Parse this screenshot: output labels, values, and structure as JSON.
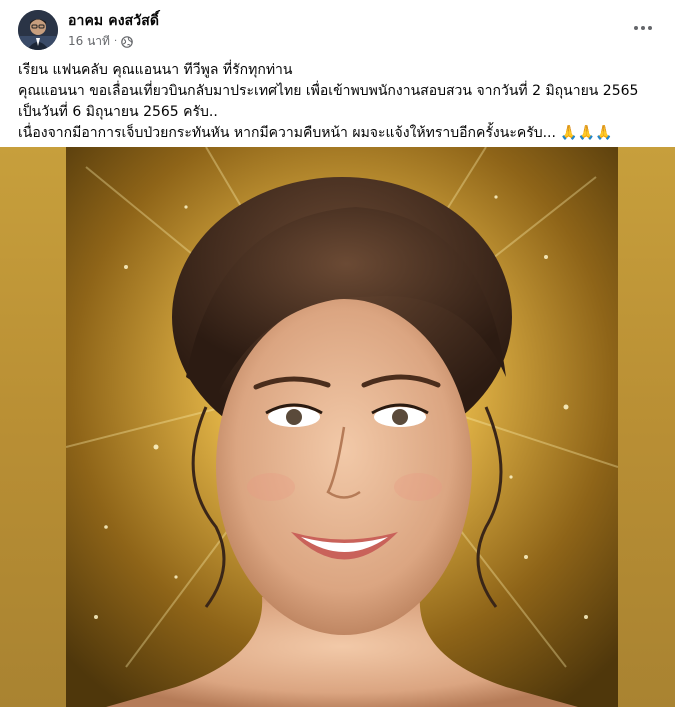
{
  "post": {
    "author": "อาคม คงสวัสดิ์",
    "time": "16 นาที",
    "dot": "·",
    "lines": [
      "เรียน แฟนคลับ คุณแอนนา ทีวีพูล ที่รักทุกท่าน",
      "คุณแอนนา ขอเลื่อนเที่ยวบินกลับมาประเทศไทย เพื่อเข้าพบพนักงานสอบสวน จากวันที่ 2 มิถุนายน 2565",
      "เป็นวันที่ 6 มิถุนายน 2565 ครับ..",
      "เนื่องจากมีอาการเจ็บป่วยกระทันหัน หากมีความคืบหน้า ผมจะแจ้งให้ทราบอีกครั้งนะครับ..."
    ],
    "emoji": "🙏🙏🙏"
  },
  "icons": {
    "privacy": "globe-icon",
    "menu": "more-horizontal-icon",
    "photo": "portrait-photo"
  },
  "colors": {
    "name": "#050505",
    "meta": "#65676b",
    "gold_background": "#c79f3c"
  }
}
